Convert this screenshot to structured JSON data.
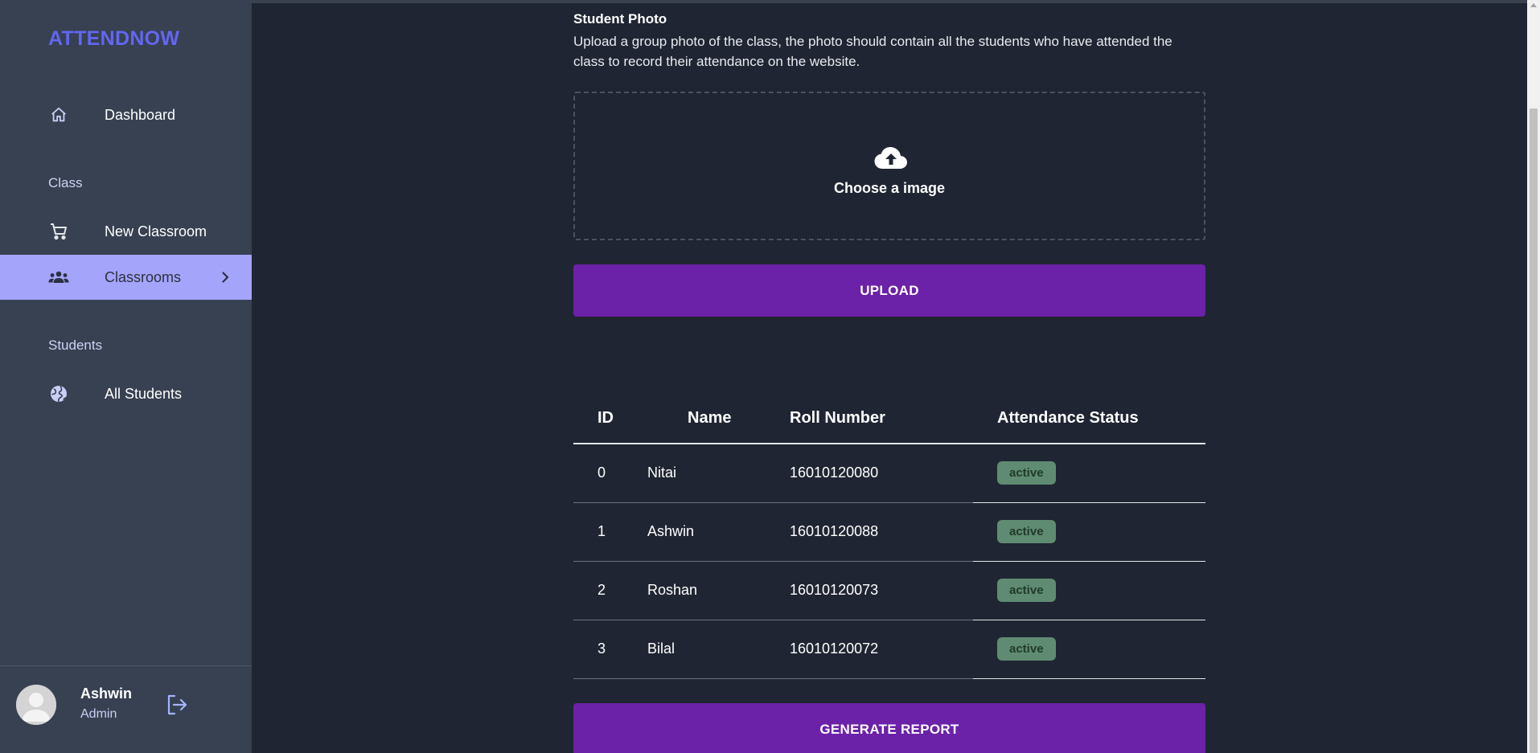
{
  "brand": "ATTENDNOW",
  "sidebar": {
    "dashboard": {
      "label": "Dashboard",
      "icon": "home-icon"
    },
    "class_section": "Class",
    "new_classroom": {
      "label": "New Classroom",
      "icon": "cart-icon"
    },
    "classrooms": {
      "label": "Classrooms",
      "icon": "groups-icon"
    },
    "students_section": "Students",
    "all_students": {
      "label": "All Students",
      "icon": "globe-icon"
    }
  },
  "user": {
    "name": "Ashwin",
    "role": "Admin"
  },
  "upload_section": {
    "title": "Student Photo",
    "description": "Upload a group photo of the class, the photo should contain all the students who have attended the class to record their attendance on the website.",
    "dropzone_label": "Choose a image",
    "upload_button": "UPLOAD"
  },
  "table": {
    "headers": [
      "ID",
      "Name",
      "Roll Number",
      "Attendance Status"
    ],
    "rows": [
      {
        "id": "0",
        "name": "Nitai",
        "roll": "16010120080",
        "status": "active"
      },
      {
        "id": "1",
        "name": "Ashwin",
        "roll": "16010120088",
        "status": "active"
      },
      {
        "id": "2",
        "name": "Roshan",
        "roll": "16010120073",
        "status": "active"
      },
      {
        "id": "3",
        "name": "Bilal",
        "roll": "16010120072",
        "status": "active"
      }
    ]
  },
  "report_button": "GENERATE REPORT",
  "colors": {
    "brand": "#6366f1",
    "sidebar_bg": "#374151",
    "main_bg": "#1f2532",
    "active_nav": "#a5a4fb",
    "button": "#6b21a8",
    "badge": "#5f8b72"
  }
}
